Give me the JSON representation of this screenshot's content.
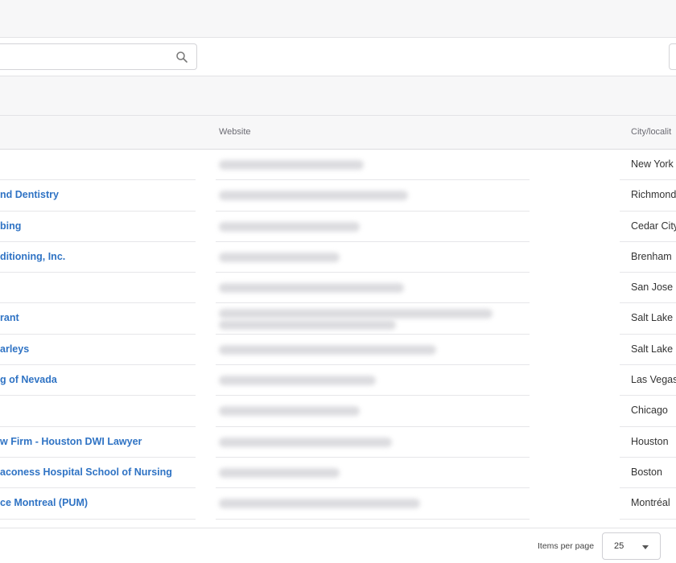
{
  "search": {
    "placeholder": "",
    "value": ""
  },
  "table": {
    "headers": {
      "website": "Website",
      "city": "City/localit"
    },
    "rows": [
      {
        "name": "",
        "city": "New York"
      },
      {
        "name": "nd Dentistry",
        "city": "Richmond"
      },
      {
        "name": "bing",
        "city": "Cedar City"
      },
      {
        "name": "ditioning, Inc.",
        "city": "Brenham"
      },
      {
        "name": "",
        "city": "San Jose"
      },
      {
        "name": "rant",
        "city": "Salt Lake C"
      },
      {
        "name": "arleys",
        "city": "Salt Lake C"
      },
      {
        "name": "g of Nevada",
        "city": "Las Vegas"
      },
      {
        "name": "",
        "city": "Chicago"
      },
      {
        "name": "w Firm - Houston DWI Lawyer",
        "city": "Houston"
      },
      {
        "name": "aconess Hospital School of Nursing",
        "city": "Boston"
      },
      {
        "name": "ce Montreal (PUM)",
        "city": "Montréal"
      }
    ]
  },
  "footer": {
    "items_per_page_label": "Items per page",
    "items_per_page_value": "25"
  },
  "icons": {
    "search": "search-icon",
    "dropdown": "caret-down-icon"
  },
  "colors": {
    "link": "#2f73c4",
    "header_bg": "#f7f7f8",
    "border": "#e3e3e6"
  }
}
